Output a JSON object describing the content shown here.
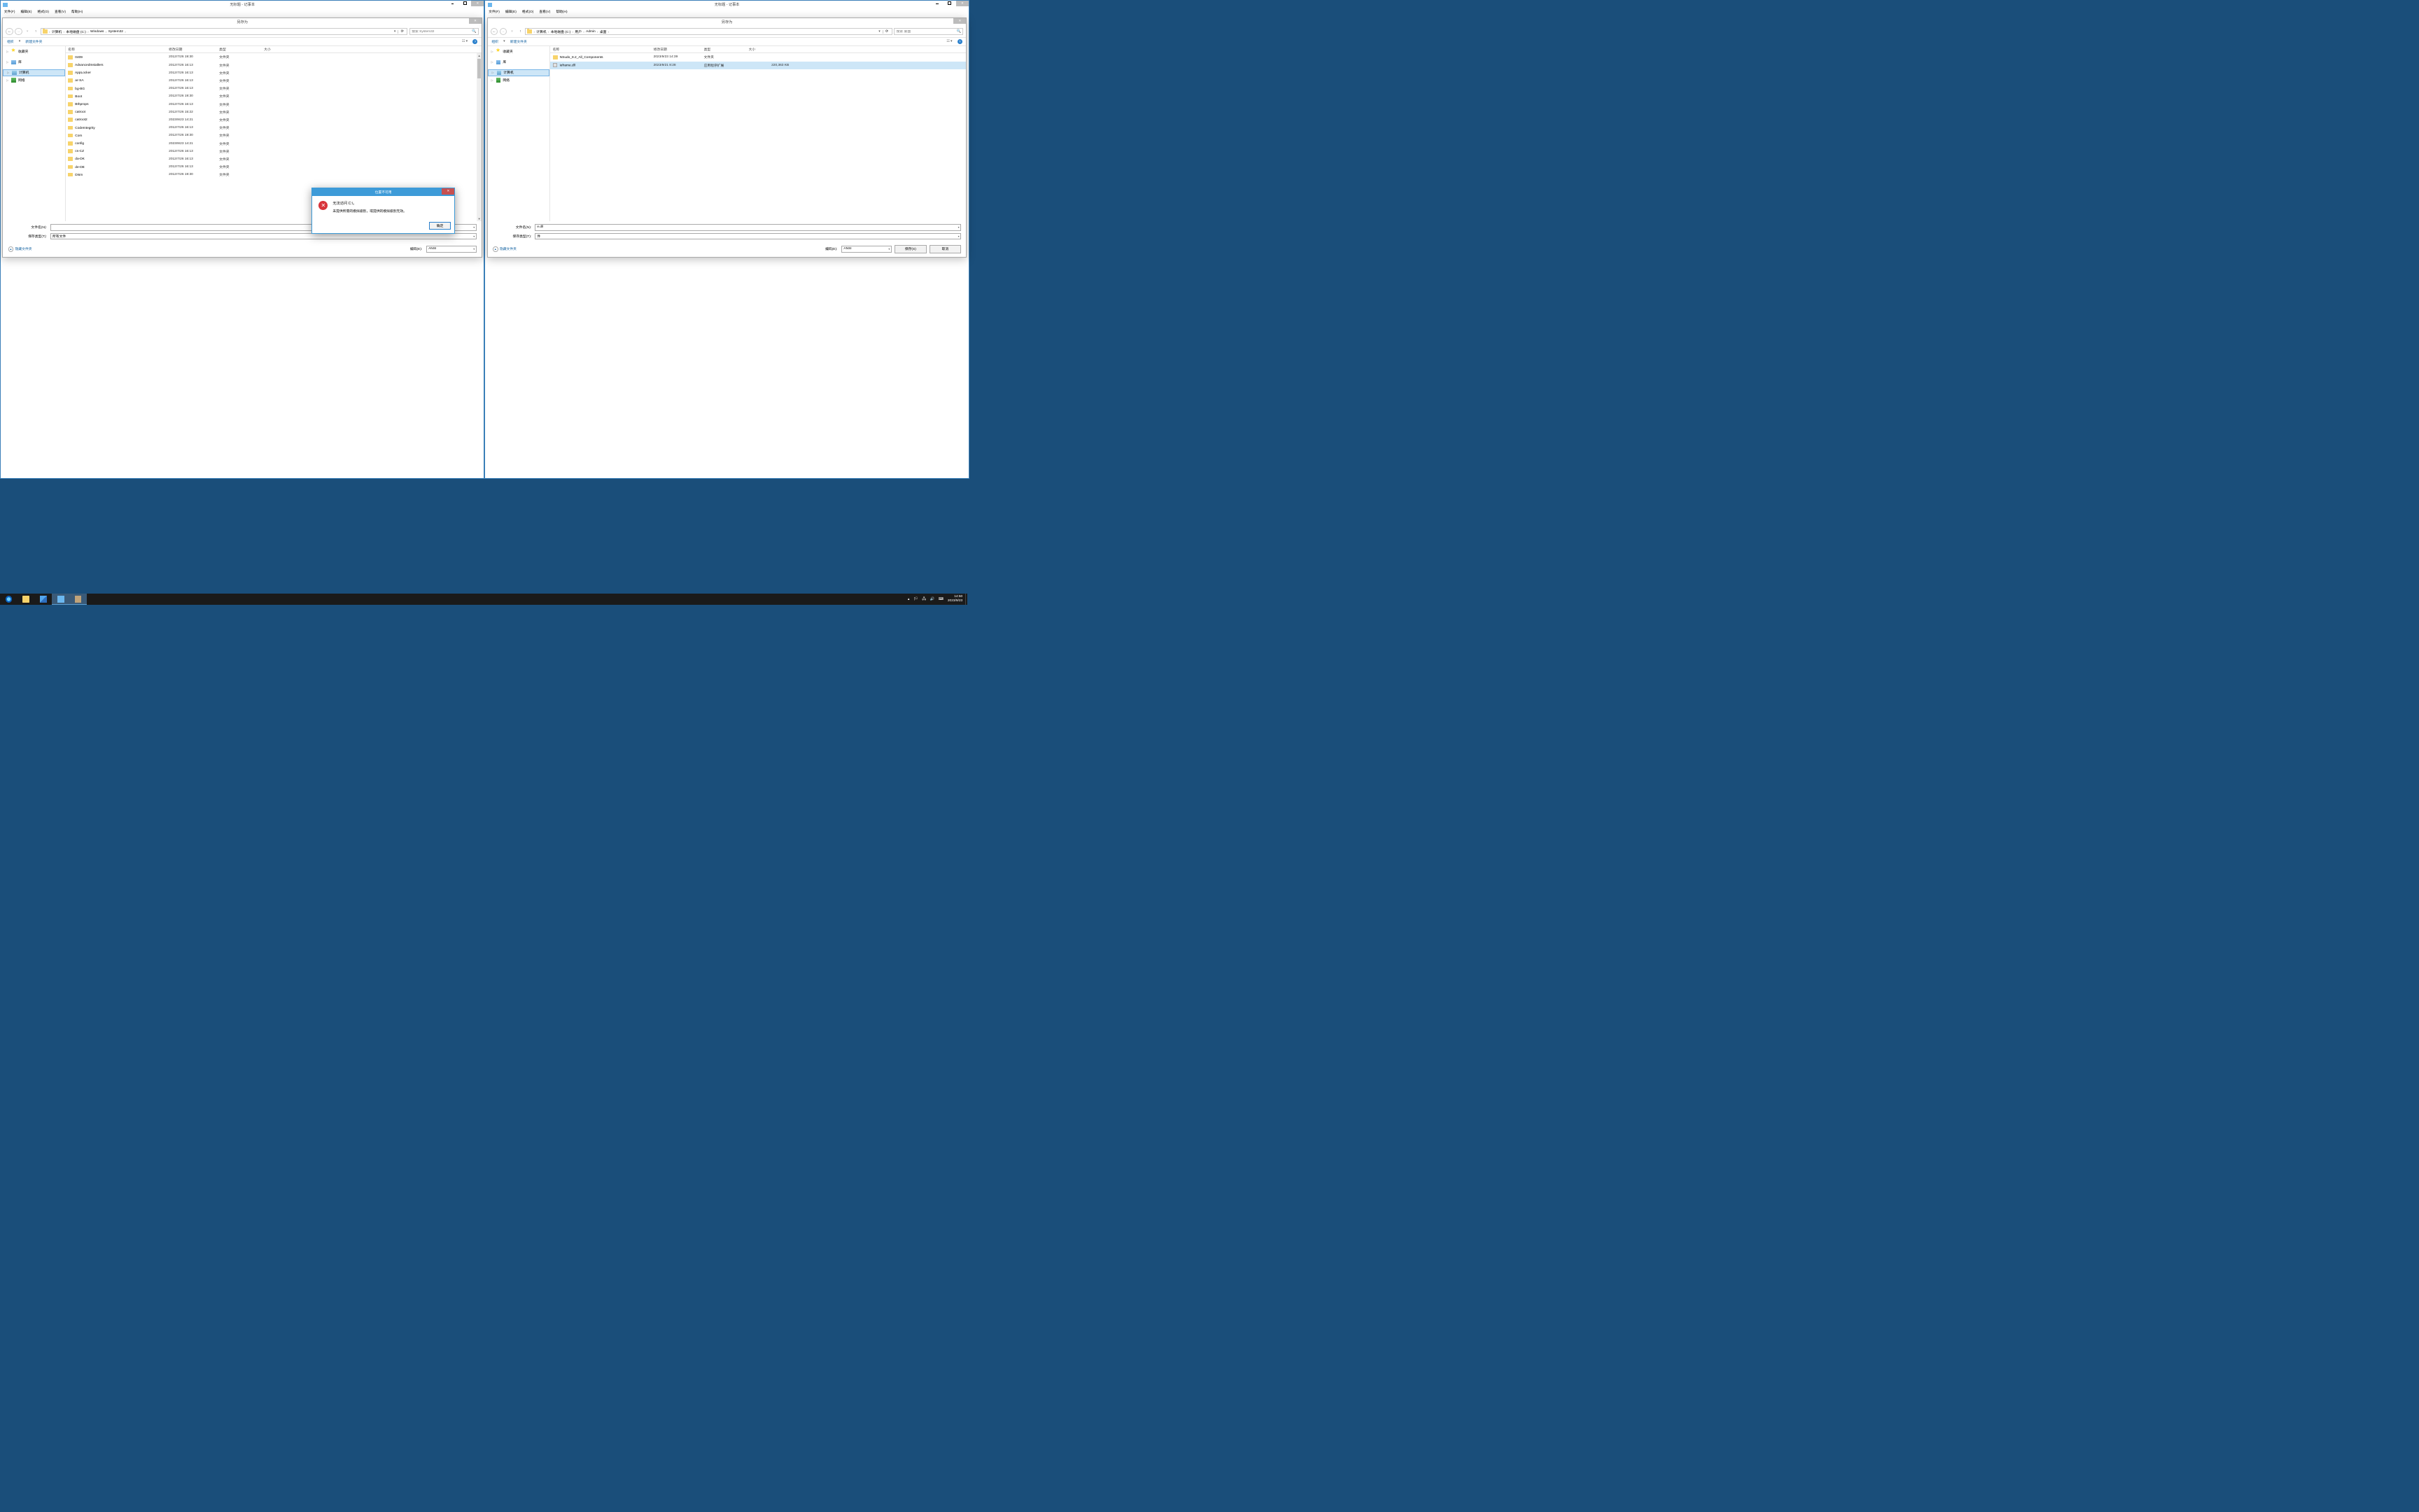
{
  "app": {
    "title": "无标题 - 记事本",
    "menus": [
      "文件(F)",
      "编辑(E)",
      "格式(O)",
      "查看(V)",
      "帮助(H)"
    ]
  },
  "saveas": {
    "title": "另存为",
    "toolbar": {
      "organize": "组织",
      "new_folder": "新建文件夹"
    },
    "columns": {
      "name": "名称",
      "date": "修改日期",
      "type": "类型",
      "size": "大小"
    },
    "filename_label": "文件名(N):",
    "savetype_label": "保存类型(T):",
    "savetype_value": "所有文件",
    "hide_folders": "隐藏文件夹",
    "encoding_label": "编码(E):",
    "encoding_value": "ANSI",
    "save_btn": "保存(S)",
    "cancel_btn": "取消"
  },
  "left": {
    "breadcrumbs": [
      "计算机",
      "本地磁盘 (C:)",
      "Windows",
      "System32"
    ],
    "search_placeholder": "搜索 System32",
    "side_nav": [
      {
        "label": "收藏夹",
        "icon": "star"
      },
      {
        "label": "库",
        "icon": "lib"
      },
      {
        "label": "计算机",
        "icon": "pc",
        "selected": true
      },
      {
        "label": "网络",
        "icon": "net"
      }
    ],
    "files": [
      {
        "name": "0409",
        "date": "2012/7/26 19:30",
        "type": "文件夹",
        "size": ""
      },
      {
        "name": "AdvancedInstallers",
        "date": "2012/7/26 16:13",
        "type": "文件夹",
        "size": ""
      },
      {
        "name": "AppLocker",
        "date": "2012/7/26 16:13",
        "type": "文件夹",
        "size": ""
      },
      {
        "name": "ar-SA",
        "date": "2012/7/26 16:13",
        "type": "文件夹",
        "size": ""
      },
      {
        "name": "bg-BG",
        "date": "2012/7/26 16:13",
        "type": "文件夹",
        "size": ""
      },
      {
        "name": "Boot",
        "date": "2012/7/26 19:30",
        "type": "文件夹",
        "size": ""
      },
      {
        "name": "Bthprops",
        "date": "2012/7/26 16:13",
        "type": "文件夹",
        "size": ""
      },
      {
        "name": "catroot",
        "date": "2012/7/26 15:22",
        "type": "文件夹",
        "size": ""
      },
      {
        "name": "catroot2",
        "date": "2023/9/23 14:21",
        "type": "文件夹",
        "size": ""
      },
      {
        "name": "CodeIntegrity",
        "date": "2012/7/26 16:13",
        "type": "文件夹",
        "size": ""
      },
      {
        "name": "Com",
        "date": "2012/7/26 19:30",
        "type": "文件夹",
        "size": ""
      },
      {
        "name": "config",
        "date": "2023/9/23 14:21",
        "type": "文件夹",
        "size": ""
      },
      {
        "name": "cs-CZ",
        "date": "2012/7/26 16:13",
        "type": "文件夹",
        "size": ""
      },
      {
        "name": "da-DK",
        "date": "2012/7/26 16:13",
        "type": "文件夹",
        "size": ""
      },
      {
        "name": "de-DE",
        "date": "2012/7/26 16:13",
        "type": "文件夹",
        "size": ""
      },
      {
        "name": "Dism",
        "date": "2012/7/26 19:30",
        "type": "文件夹",
        "size": ""
      }
    ],
    "filename_value": ""
  },
  "right": {
    "breadcrumbs": [
      "计算机",
      "本地磁盘 (C:)",
      "用户",
      "Admin",
      "桌面"
    ],
    "search_placeholder": "搜索 桌面",
    "side_nav": [
      {
        "label": "收藏夹",
        "icon": "star"
      },
      {
        "label": "库",
        "icon": "lib"
      },
      {
        "label": "计算机",
        "icon": "pc",
        "selected": true
      },
      {
        "label": "网络",
        "icon": "net"
      }
    ],
    "files": [
      {
        "name": "NSudo_8.2_All_Components",
        "date": "2023/9/23 14:39",
        "type": "文件夹",
        "size": ""
      },
      {
        "name": "ieframe.dll",
        "date": "2023/9/21 8:28",
        "type": "应用程序扩展",
        "size": "220,363 KB",
        "selected": true,
        "ico": "dll"
      }
    ],
    "filename_value": "e.dll",
    "savetype_value_suffix": "件"
  },
  "error": {
    "title": "位置不可用",
    "heading": "无法访问 C:\\。",
    "message": "未提供所需的模拟级别，或提供的模拟级别无效。",
    "ok": "确定"
  },
  "taskbar": {
    "time": "14:50",
    "date": "2023/9/23"
  }
}
